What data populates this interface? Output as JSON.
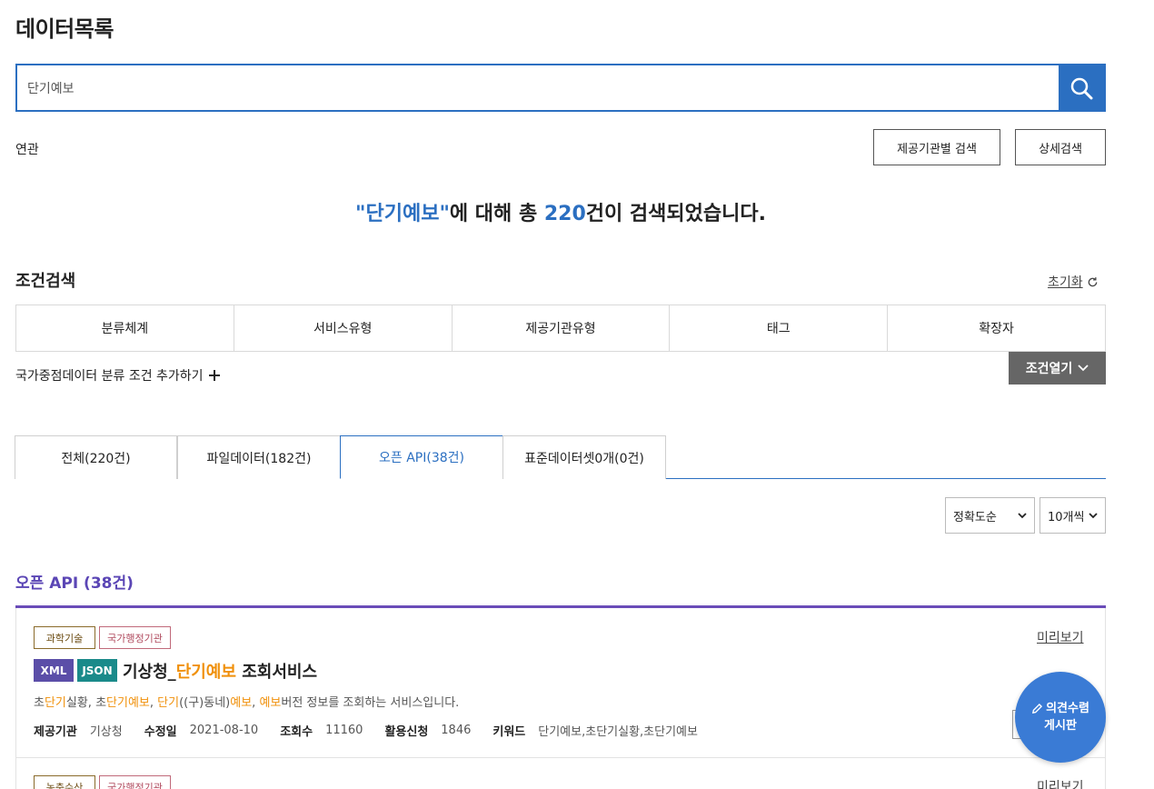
{
  "page": {
    "title": "데이터목록"
  },
  "search": {
    "value": "단기예보",
    "placeholder": ""
  },
  "related": {
    "label": "연관"
  },
  "buttons": {
    "provider_search": "제공기관별 검색",
    "detail_search": "상세검색"
  },
  "result": {
    "quote_open": "\"",
    "keyword": "단기예보",
    "quote_close": "\"",
    "prefix": "에 대해 총 ",
    "count": "220",
    "suffix": "건이 검색되었습니다."
  },
  "conditions": {
    "title": "조건검색",
    "reset_label": "초기화",
    "filters": [
      "분류체계",
      "서비스유형",
      "제공기관유형",
      "태그",
      "확장자"
    ],
    "add_label": "국가중점데이터 분류 조건 추가하기",
    "open_label": "조건열기"
  },
  "tabs": [
    {
      "label": "전체(220건)",
      "active": false
    },
    {
      "label": "파일데이터(182건)",
      "active": false
    },
    {
      "label": "오픈 API(38건)",
      "active": true
    },
    {
      "label": "표준데이터셋0개(0건)",
      "active": false
    }
  ],
  "sort": {
    "order": "정확도순",
    "page_size": "10개씩"
  },
  "section": {
    "title": "오픈 API (38건)"
  },
  "items": [
    {
      "badges": [
        "과학기술",
        "국가행정기관"
      ],
      "preview": "미리보기",
      "formats": [
        "XML",
        "JSON"
      ],
      "title_pre": "기상청_",
      "title_kw": "단기예보",
      "title_post": " 조회서비스",
      "desc_parts": [
        "초",
        "단기",
        "실황, 초",
        "단기예보",
        ", ",
        "단기",
        "((구)동네)",
        "예보",
        ", ",
        "예보",
        "버전 정보를 조회하는 서비스입니다."
      ],
      "meta": {
        "provider_label": "제공기관",
        "provider": "기상청",
        "modified_label": "수정일",
        "modified": "2021-08-10",
        "views_label": "조회수",
        "views": "11160",
        "apply_label": "활용신청",
        "apply": "1846",
        "keyword_label": "키워드",
        "keywords": "단기예보,초단기실황,초단기예보"
      }
    },
    {
      "badges": [
        "농축수산",
        "국가행정기관"
      ],
      "preview": "미리보기"
    }
  ],
  "fab": {
    "line1": "의견수렴",
    "line2": "게시판"
  },
  "colors": {
    "accent": "#2b6fc1",
    "purple": "#5b46b5",
    "keyword": "#f0900a",
    "xml": "#5b4ea8",
    "json": "#1a8a8a"
  }
}
